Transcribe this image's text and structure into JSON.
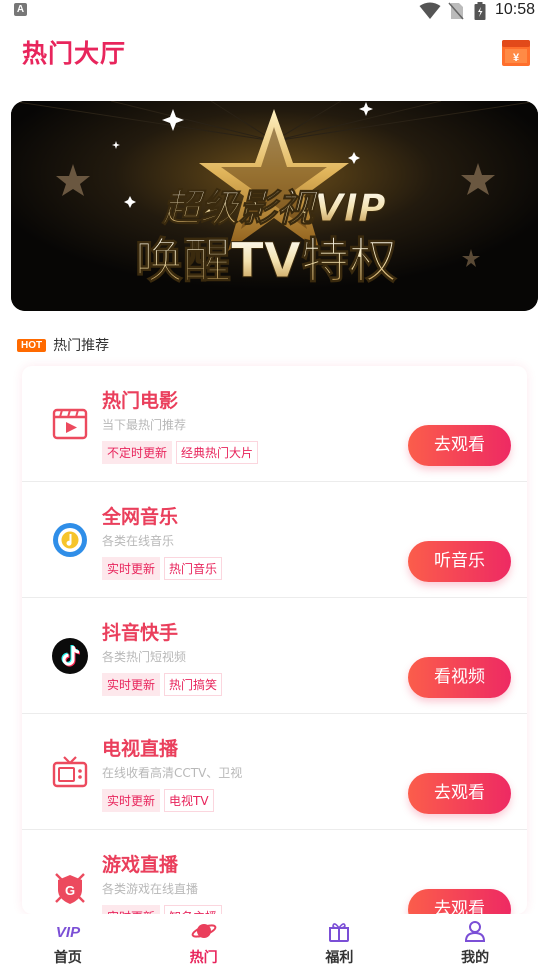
{
  "status_bar": {
    "notification": "A",
    "time": "10:58"
  },
  "header": {
    "title": "热门大厅",
    "wallet_icon": "wallet-icon",
    "wallet_symbol": "¥"
  },
  "banner": {
    "line1": "超级影视VIP",
    "line2": "唤醒TV特权"
  },
  "section": {
    "badge": "HOT",
    "title": "热门推荐"
  },
  "cards": [
    {
      "name": "热门电影",
      "desc": "当下最热门推荐",
      "tags": [
        "不定时更新",
        "经典热门大片"
      ],
      "button": "去观看",
      "icon": "movie-icon"
    },
    {
      "name": "全网音乐",
      "desc": "各类在线音乐",
      "tags": [
        "实时更新",
        "热门音乐"
      ],
      "button": "听音乐",
      "icon": "music-icon"
    },
    {
      "name": "抖音快手",
      "desc": "各类热门短视频",
      "tags": [
        "实时更新",
        "热门搞笑"
      ],
      "button": "看视频",
      "icon": "tiktok-icon"
    },
    {
      "name": "电视直播",
      "desc": "在线收看高清CCTV、卫视",
      "tags": [
        "实时更新",
        "电视TV"
      ],
      "button": "去观看",
      "icon": "tv-icon"
    },
    {
      "name": "游戏直播",
      "desc": "各类游戏在线直播",
      "tags": [
        "实时更新",
        "知名主播"
      ],
      "button": "去观看",
      "icon": "game-icon"
    }
  ],
  "tabbar": {
    "items": [
      {
        "label": "首页",
        "icon": "vip-icon"
      },
      {
        "label": "热门",
        "icon": "planet-icon"
      },
      {
        "label": "福利",
        "icon": "gift-icon"
      },
      {
        "label": "我的",
        "icon": "user-icon"
      }
    ],
    "active_index": 1
  },
  "colors": {
    "accent": "#e8255c",
    "button_start": "#fb5d4b",
    "button_end": "#ee2a63",
    "hot_badge": "#ff6a00"
  }
}
